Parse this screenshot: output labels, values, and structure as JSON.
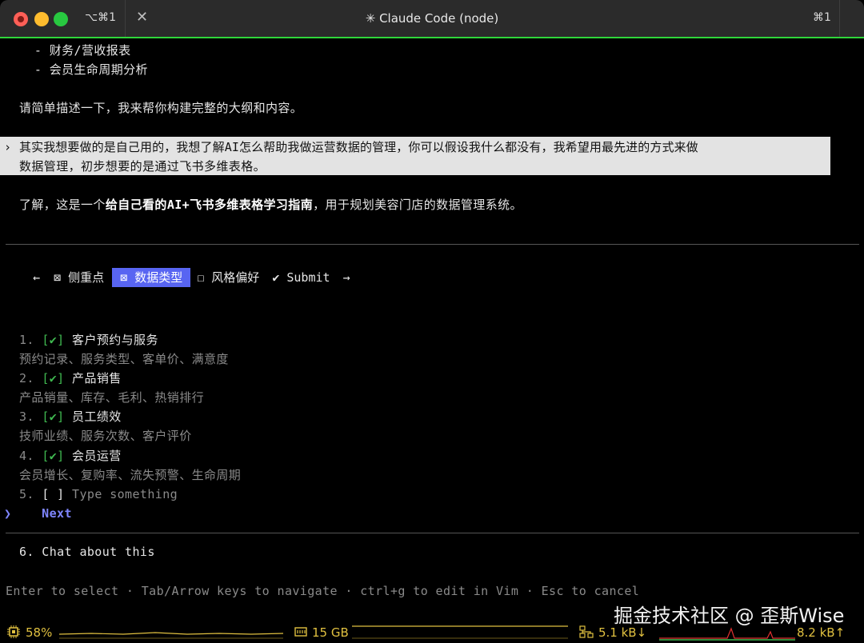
{
  "titlebar": {
    "tab_shortcut": "⌥⌘1",
    "close_glyph": "✕",
    "title": "✳ Claude Code (node)",
    "right_shortcut": "⌘1"
  },
  "conversation": {
    "list_items": [
      "  - 财务/营收报表",
      "  - 会员生命周期分析"
    ],
    "assistant_prompt": "请简单描述一下，我来帮你构建完整的大纲和内容。",
    "user_message_line1": "其实我想要做的是自己用的，我想了解AI怎么帮助我做运营数据的管理，你可以假设我什么都没有，我希望用最先进的方式来做",
    "user_message_line2": "数据管理，初步想要的是通过飞书多维表格。",
    "reply_prefix": "了解，这是一个",
    "reply_bold": "给自己看的AI+飞书多维表格学习指南",
    "reply_suffix": "，用于规划美容门店的数据管理系统。"
  },
  "question_tabs": {
    "left_arrow": "←",
    "tabs": [
      {
        "label": "⊠ 侧重点",
        "active": false
      },
      {
        "label": "⊠ 数据类型",
        "active": true
      },
      {
        "label": "☐ 风格偏好",
        "active": false
      },
      {
        "label": "✔ Submit",
        "active": false
      }
    ],
    "right_arrow": "→"
  },
  "options": [
    {
      "num": "1.",
      "check": "[✔]",
      "title": "客户预约与服务",
      "desc": "预约记录、服务类型、客单价、满意度"
    },
    {
      "num": "2.",
      "check": "[✔]",
      "title": "产品销售",
      "desc": "产品销量、库存、毛利、热销排行"
    },
    {
      "num": "3.",
      "check": "[✔]",
      "title": "员工绩效",
      "desc": "技师业绩、服务次数、客户评价"
    },
    {
      "num": "4.",
      "check": "[✔]",
      "title": "会员运营",
      "desc": "会员增长、复购率、流失预警、生命周期"
    }
  ],
  "custom_option": {
    "num": "5.",
    "check": "[ ]",
    "placeholder": "Type something"
  },
  "next": {
    "caret": "❯",
    "label": "Next"
  },
  "chat_option": "6. Chat about this",
  "help_line": "Enter to select · Tab/Arrow keys to navigate · ctrl+g to edit in Vim · Esc to cancel",
  "statusbar": {
    "cpu": "58%",
    "mem": "15 GB",
    "net_down": "5.1 kB↓",
    "net_up": "8.2 kB↑"
  },
  "watermark": "掘金技术社区 @ 歪斯Wise"
}
